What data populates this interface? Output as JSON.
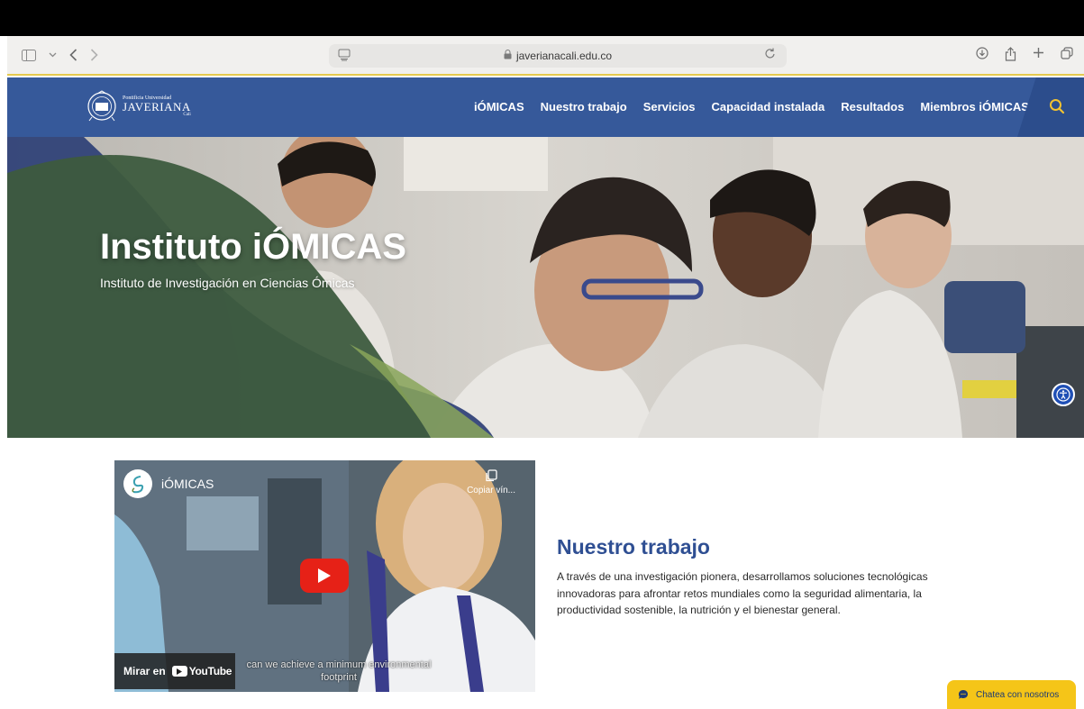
{
  "browser": {
    "url": "javerianacali.edu.co"
  },
  "site": {
    "logo": {
      "line1": "Pontificia Universidad",
      "line2": "JAVERIANA",
      "line3": "Cali"
    },
    "nav": [
      "iÓMICAS",
      "Nuestro trabajo",
      "Servicios",
      "Capacidad instalada",
      "Resultados",
      "Miembros iÓMICAS"
    ]
  },
  "hero": {
    "title": "Instituto iÓMICAS",
    "subtitle": "Instituto de Investigación en Ciencias Ómicas"
  },
  "video": {
    "channel": "iÓMICAS",
    "copy_label": "Copiar vín...",
    "caption": "can we achieve a minimum environmental footprint",
    "watch_on": "Mirar en",
    "youtube": "YouTube"
  },
  "work": {
    "title": "Nuestro trabajo",
    "body": "A través de una investigación pionera, desarrollamos soluciones tecnológicas innovadoras para afrontar retos mundiales como la seguridad alimentaria, la productividad sostenible, la nutrición y el bienestar general."
  },
  "chat": {
    "label": "Chatea con nosotros"
  },
  "colors": {
    "header_blue": "#36599a",
    "title_blue": "#2f4f93",
    "chat_yellow": "#f5c518",
    "youtube_red": "#e62117",
    "accent_yellow": "#e4c94e"
  }
}
